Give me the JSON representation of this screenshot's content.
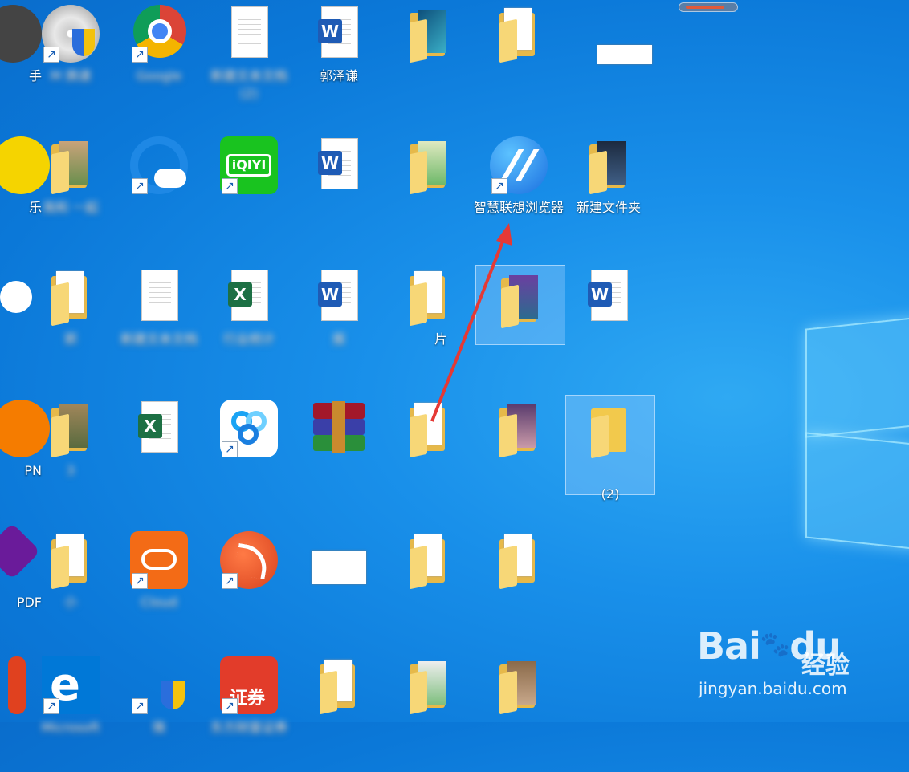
{
  "desktop": {
    "icons": [
      {
        "label": "手",
        "glyph": "partial-round-icon",
        "blurred": false
      },
      {
        "label": "M 换速",
        "glyph": "disc-shield-icon",
        "blurred": true
      },
      {
        "label": "Google",
        "glyph": "chrome-icon",
        "blurred": true
      },
      {
        "label": "新建文本文档 (2)",
        "glyph": "text-document-icon",
        "blurred": true
      },
      {
        "label": "郭泽谦",
        "glyph": "word-document-icon",
        "blurred": false
      },
      {
        "label": "",
        "glyph": "folder-icon",
        "blurred": true
      },
      {
        "label": "",
        "glyph": "folder-icon",
        "blurred": true
      },
      {
        "label": "",
        "glyph": "image-file-icon",
        "blurred": true
      },
      {
        "label": "乐",
        "glyph": "partial-round-icon",
        "blurred": false
      },
      {
        "label": "我和 一起",
        "glyph": "folder-icon",
        "blurred": true
      },
      {
        "label": "",
        "glyph": "browser-cloud-icon",
        "blurred": true
      },
      {
        "label": "",
        "glyph": "iqiyi-icon",
        "blurred": true
      },
      {
        "label": "",
        "glyph": "word-document-icon",
        "blurred": true
      },
      {
        "label": "",
        "glyph": "folder-icon",
        "blurred": true
      },
      {
        "label": "智慧联想浏览器",
        "glyph": "lenovo-browser-icon",
        "blurred": false
      },
      {
        "label": "新建文件夹",
        "glyph": "folder-icon",
        "blurred": false
      },
      {
        "label": "",
        "glyph": "partial-round-icon",
        "blurred": false
      },
      {
        "label": "郭 ",
        "glyph": "folder-icon",
        "blurred": true
      },
      {
        "label": "新建文本文档",
        "glyph": "text-document-icon",
        "blurred": true
      },
      {
        "label": "行业统计",
        "glyph": "excel-document-icon",
        "blurred": true
      },
      {
        "label": "报 ",
        "glyph": "word-document-icon",
        "blurred": true
      },
      {
        "label": "片",
        "glyph": "folder-icon",
        "blurred": true
      },
      {
        "label": "",
        "glyph": "folder-icon",
        "blurred": true
      },
      {
        "label": "",
        "glyph": "word-document-icon",
        "blurred": true
      },
      {
        "label": "PN",
        "glyph": "partial-round-icon",
        "blurred": false
      },
      {
        "label": "3",
        "glyph": "folder-icon",
        "blurred": true
      },
      {
        "label": "",
        "glyph": "excel-document-icon",
        "blurred": true
      },
      {
        "label": "",
        "glyph": "baidu-netdisk-icon",
        "blurred": true
      },
      {
        "label": "",
        "glyph": "winrar-icon",
        "blurred": true
      },
      {
        "label": "",
        "glyph": "folder-icon",
        "blurred": true
      },
      {
        "label": "",
        "glyph": "folder-icon",
        "blurred": true
      },
      {
        "label": "(2)",
        "glyph": "folder-icon",
        "blurred": true
      },
      {
        "label": "PDF",
        "glyph": "partial-pdf-icon",
        "blurred": false
      },
      {
        "label": "小",
        "glyph": "folder-icon",
        "blurred": true
      },
      {
        "label": "Cloud",
        "glyph": "cloud-app-icon",
        "blurred": true
      },
      {
        "label": "",
        "glyph": "red-swirl-app-icon",
        "blurred": true
      },
      {
        "label": "",
        "glyph": "image-file-icon",
        "blurred": true
      },
      {
        "label": "",
        "glyph": "folder-icon",
        "blurred": true
      },
      {
        "label": "",
        "glyph": "folder-icon",
        "blurred": true
      },
      {
        "label": "",
        "glyph": "partial-red-icon",
        "blurred": false
      },
      {
        "label": "Microsoft",
        "glyph": "edge-icon",
        "blurred": true
      },
      {
        "label": "微",
        "glyph": "shield-icon",
        "blurred": true
      },
      {
        "label": "东方财富证券",
        "glyph": "securities-app-icon",
        "blurred": true
      },
      {
        "label": "",
        "glyph": "folder-icon",
        "blurred": true
      },
      {
        "label": "",
        "glyph": "folder-icon",
        "blurred": true
      },
      {
        "label": "",
        "glyph": "folder-icon",
        "blurred": true
      }
    ]
  },
  "watermark": {
    "brand": "Bai",
    "brand2": "du",
    "cn": "经验",
    "url": "jingyan.baidu.com"
  },
  "colors": {
    "desktop": "#1990ea",
    "arrow": "#e53935",
    "folder": "#f7d777"
  }
}
